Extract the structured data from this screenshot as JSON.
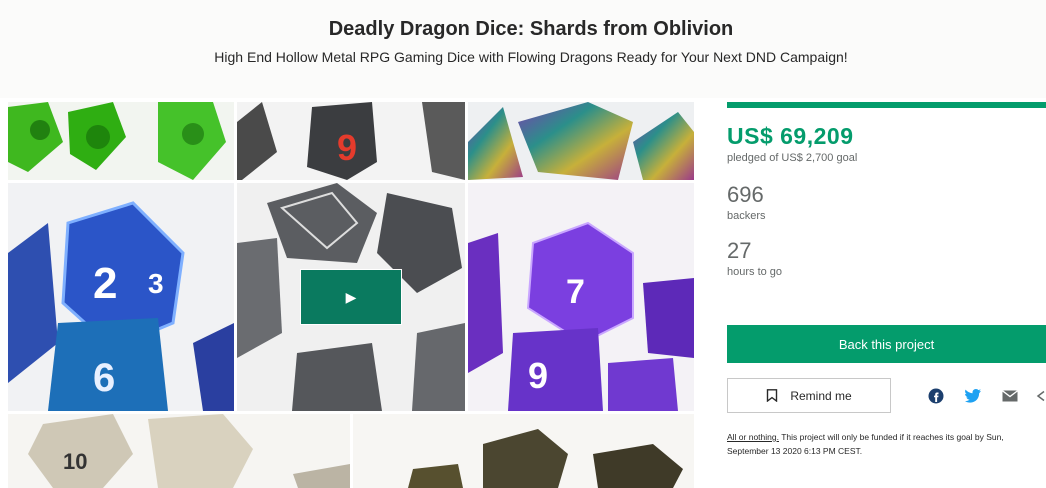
{
  "project": {
    "title": "Deadly Dragon Dice: Shards from Oblivion",
    "subtitle": "High End Hollow Metal RPG Gaming Dice with Flowing Dragons Ready for Your Next DND Campaign!"
  },
  "colors": {
    "accent": "#049c6c",
    "play_button": "#0a7a5f",
    "muted_text": "#656969"
  },
  "gallery": {
    "images": [
      "green-dice-image",
      "black-red-dice-image",
      "rainbow-dice-image",
      "blue-dice-image",
      "silver-dice-image",
      "purple-dice-image",
      "gold-silver-dice-image",
      "bronze-dice-image"
    ],
    "play_icon": "▶"
  },
  "stats": {
    "funding_progress_percent": 100,
    "pledged_amount": "US$ 69,209",
    "pledged_label": "pledged of US$ 2,700 goal",
    "backers_count": "696",
    "backers_label": "backers",
    "time_left": "27",
    "time_left_label": "hours to go"
  },
  "actions": {
    "back_label": "Back this project",
    "remind_label": "Remind me",
    "remind_icon": "bookmark-icon",
    "share_icons": [
      "facebook-icon",
      "twitter-icon",
      "email-icon",
      "share-icon"
    ]
  },
  "funding_note": {
    "link_text": "All or nothing.",
    "text": " This project will only be funded if it reaches its goal by Sun, September 13 2020 6:13 PM CEST."
  }
}
